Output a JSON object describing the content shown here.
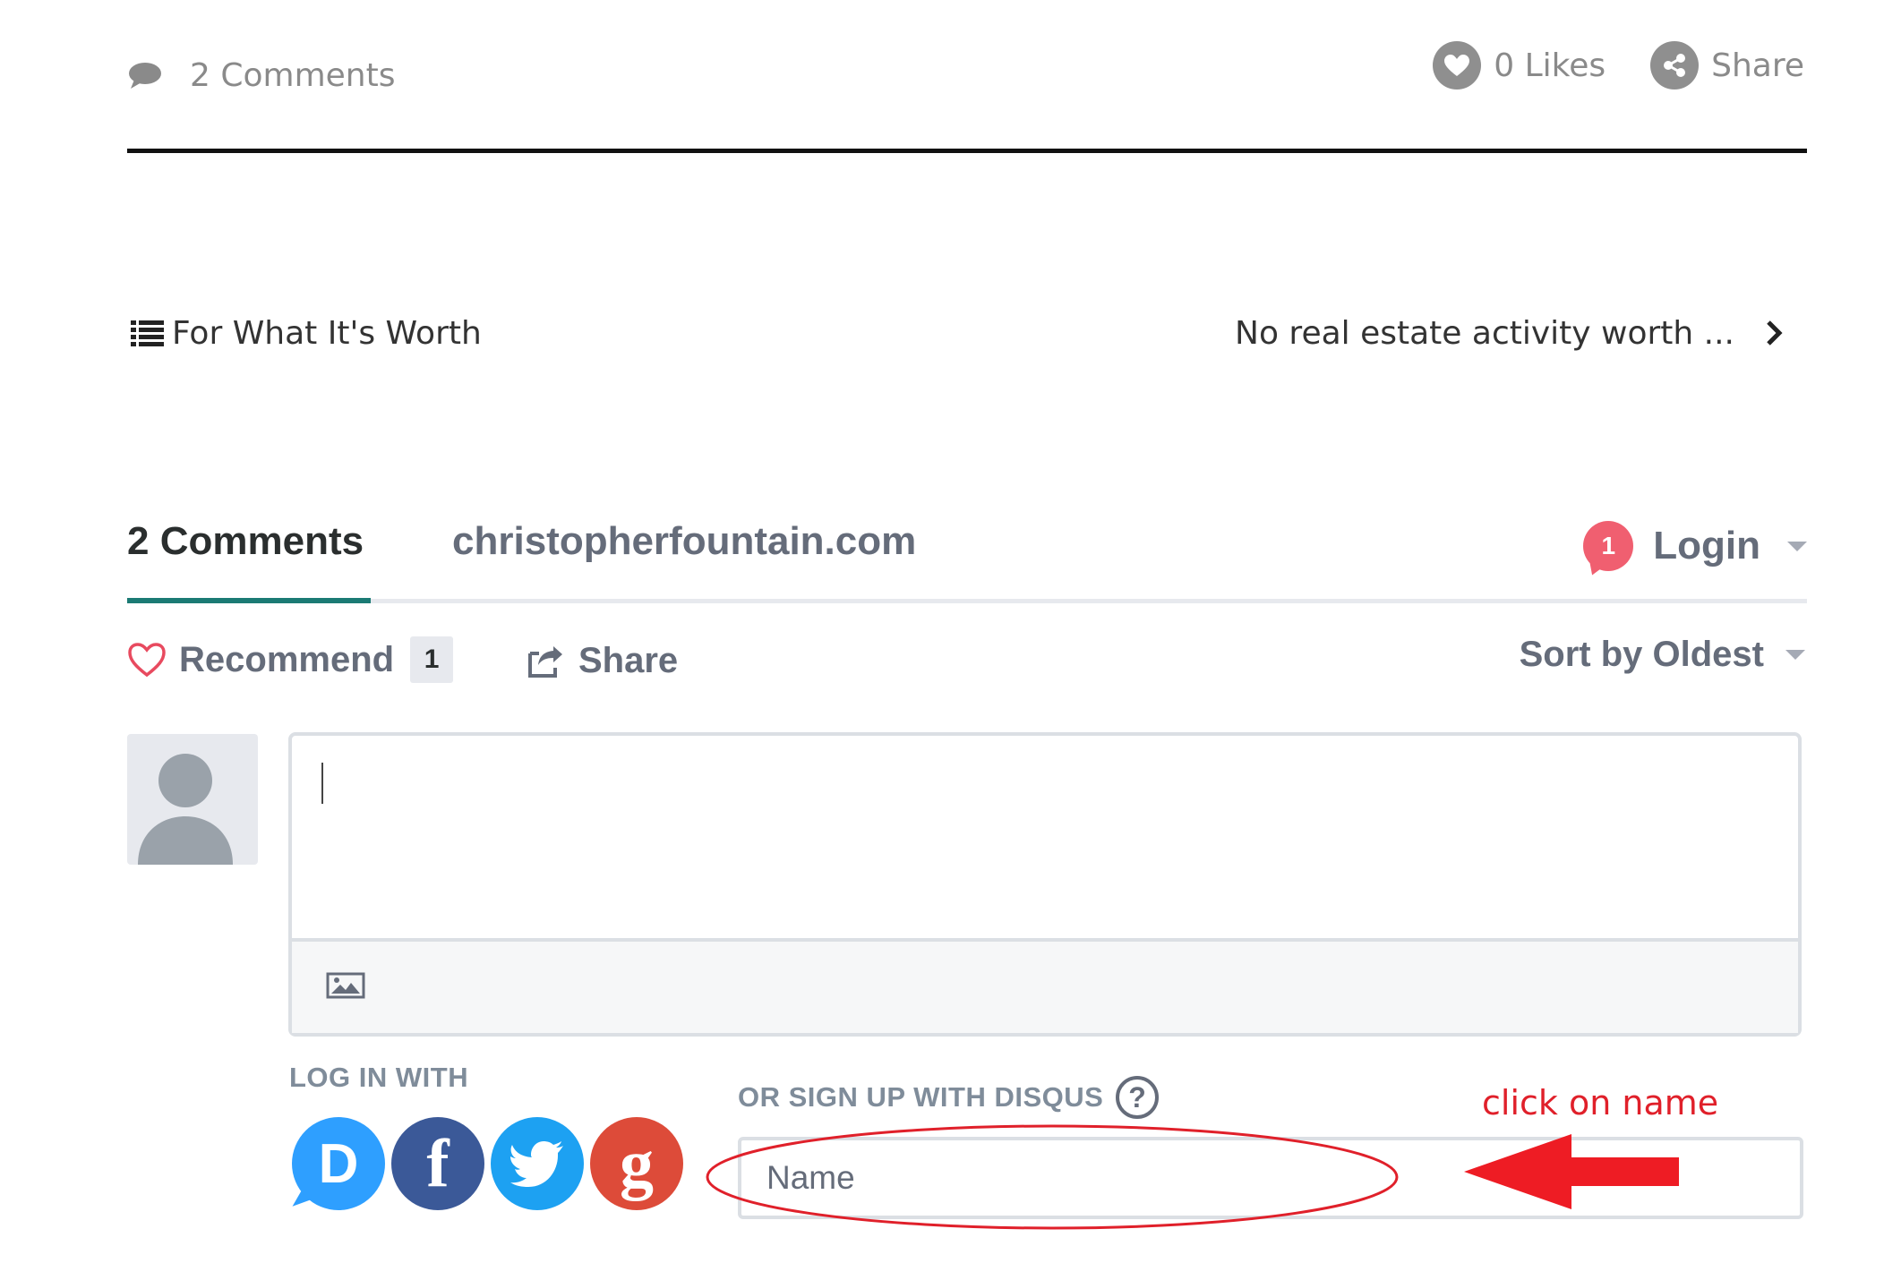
{
  "post_meta": {
    "comments_label": "2 Comments",
    "likes_label": "0 Likes",
    "share_label": "Share"
  },
  "post_nav": {
    "prev_title": "For What It's Worth",
    "next_title": "No real estate activity worth ..."
  },
  "disqus": {
    "tab_comments": "2 Comments",
    "tab_site": "christopherfountain.com",
    "notification_count": "1",
    "login_label": "Login",
    "recommend_label": "Recommend",
    "recommend_count": "1",
    "share_label": "Share",
    "sort_label": "Sort by Oldest",
    "composer_placeholder": "",
    "log_in_with_label": "LOG IN WITH",
    "social_providers": [
      "disqus",
      "facebook",
      "twitter",
      "google"
    ],
    "signup_label": "OR SIGN UP WITH DISQUS",
    "name_placeholder": "Name"
  },
  "annotation": {
    "text": "click on name"
  },
  "colors": {
    "accent_underline": "#1b7a74",
    "badge": "#f05f70",
    "annotation_red": "#e0202a",
    "disqus_blue": "#2e9fff",
    "facebook_blue": "#3b5998",
    "twitter_blue": "#1da1f2",
    "google_red": "#dd4b39"
  }
}
